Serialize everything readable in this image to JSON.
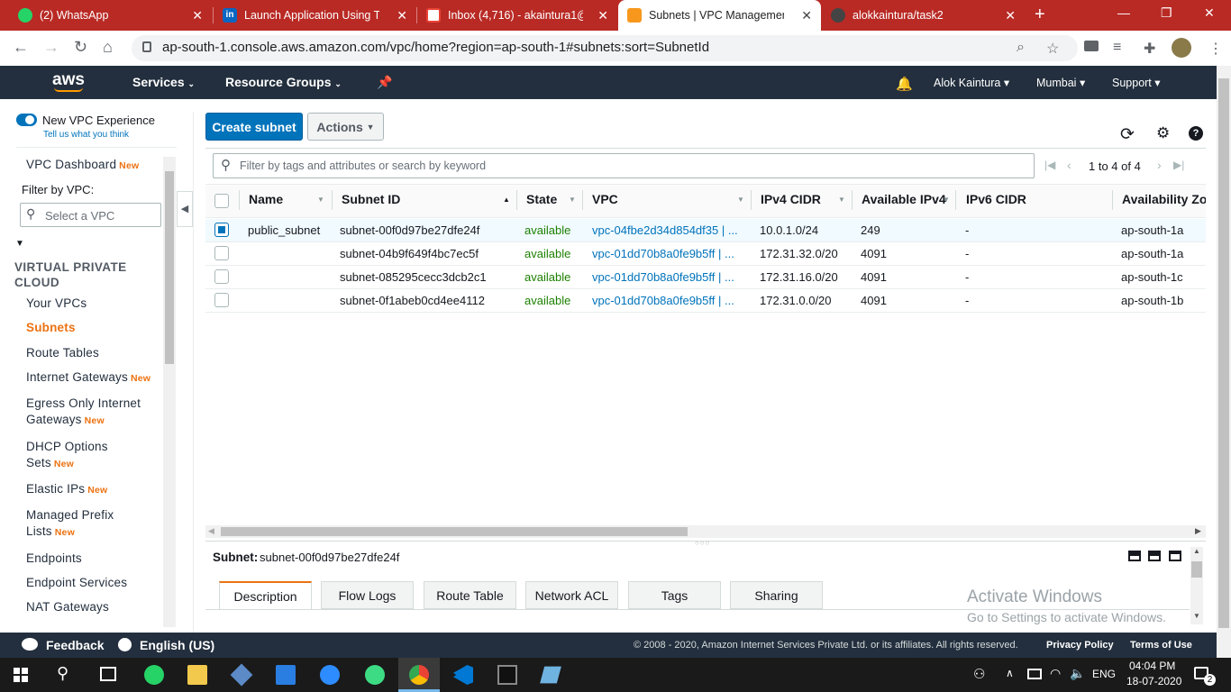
{
  "browser": {
    "tabs": [
      {
        "title": "(2) WhatsApp",
        "color": "#25d366",
        "icon": "whatsapp-icon"
      },
      {
        "title": "Launch Application Using Ter",
        "color": "#0a66c2",
        "icon": "linkedin-icon"
      },
      {
        "title": "Inbox (4,716) - akaintura1@g",
        "color": "#ea4335",
        "icon": "gmail-icon"
      },
      {
        "title": "Subnets | VPC Management",
        "color": "#f7981d",
        "icon": "aws-box-icon"
      },
      {
        "title": "alokkaintura/task2",
        "color": "#444444",
        "icon": "github-icon"
      }
    ],
    "new_tab": "+",
    "url": "ap-south-1.console.aws.amazon.com/vpc/home?region=ap-south-1#subnets:sort=SubnetId"
  },
  "header": {
    "logo": "aws",
    "services": "Services",
    "resource_groups": "Resource Groups",
    "user": "Alok Kaintura",
    "region": "Mumbai",
    "support": "Support"
  },
  "sidebar": {
    "toggle_label": "New VPC Experience",
    "toggle_sub": "Tell us what you think",
    "dashboard": "VPC Dashboard",
    "new_tag": "New",
    "filter_label": "Filter by VPC:",
    "filter_placeholder": "Select a VPC",
    "section": "VIRTUAL PRIVATE CLOUD",
    "items": [
      {
        "label": "Your VPCs",
        "new": false
      },
      {
        "label": "Subnets",
        "new": false,
        "active": true
      },
      {
        "label": "Route Tables",
        "new": false
      },
      {
        "label": "Internet Gateways",
        "new": true
      },
      {
        "label": "Egress Only Internet Gateways",
        "new": true
      },
      {
        "label": "DHCP Options Sets",
        "new": true
      },
      {
        "label": "Elastic IPs",
        "new": true
      },
      {
        "label": "Managed Prefix Lists",
        "new": true
      },
      {
        "label": "Endpoints",
        "new": false
      },
      {
        "label": "Endpoint Services",
        "new": false
      },
      {
        "label": "NAT Gateways",
        "new": false
      }
    ]
  },
  "toolbar": {
    "create": "Create subnet",
    "actions": "Actions",
    "filter_placeholder": "Filter by tags and attributes or search by keyword",
    "pagination": "1 to 4 of 4"
  },
  "table": {
    "columns": [
      "Name",
      "Subnet ID",
      "State",
      "VPC",
      "IPv4 CIDR",
      "Available IPv4",
      "IPv6 CIDR",
      "Availability Zor"
    ],
    "rows": [
      {
        "name": "public_subnet",
        "id": "subnet-00f0d97be27dfe24f",
        "state": "available",
        "vpc": "vpc-04fbe2d34d854df35 | ...",
        "cidr": "10.0.1.0/24",
        "avail": "249",
        "ipv6": "-",
        "az": "ap-south-1a",
        "selected": true
      },
      {
        "name": "",
        "id": "subnet-04b9f649f4bc7ec5f",
        "state": "available",
        "vpc": "vpc-01dd70b8a0fe9b5ff | ...",
        "cidr": "172.31.32.0/20",
        "avail": "4091",
        "ipv6": "-",
        "az": "ap-south-1a",
        "selected": false
      },
      {
        "name": "",
        "id": "subnet-085295cecc3dcb2c1",
        "state": "available",
        "vpc": "vpc-01dd70b8a0fe9b5ff | ...",
        "cidr": "172.31.16.0/20",
        "avail": "4091",
        "ipv6": "-",
        "az": "ap-south-1c",
        "selected": false
      },
      {
        "name": "",
        "id": "subnet-0f1abeb0cd4ee4112",
        "state": "available",
        "vpc": "vpc-01dd70b8a0fe9b5ff | ...",
        "cidr": "172.31.0.0/20",
        "avail": "4091",
        "ipv6": "-",
        "az": "ap-south-1b",
        "selected": false
      }
    ]
  },
  "detail": {
    "label": "Subnet:",
    "value": "subnet-00f0d97be27dfe24f",
    "tabs": [
      "Description",
      "Flow Logs",
      "Route Table",
      "Network ACL",
      "Tags",
      "Sharing"
    ],
    "watermark_title": "Activate Windows",
    "watermark_sub": "Go to Settings to activate Windows."
  },
  "footer": {
    "feedback": "Feedback",
    "language": "English (US)",
    "copyright": "© 2008 - 2020, Amazon Internet Services Private Ltd. or its affiliates. All rights reserved.",
    "privacy": "Privacy Policy",
    "terms": "Terms of Use"
  },
  "taskbar": {
    "lang": "ENG",
    "time": "04:04 PM",
    "date": "18-07-2020",
    "notifications": "2"
  },
  "colors": {
    "aws_orange": "#ec7211",
    "aws_nav": "#232f3e",
    "primary_blue": "#0073bb",
    "chrome_red": "#b92a25",
    "available_green": "#1d8102"
  }
}
